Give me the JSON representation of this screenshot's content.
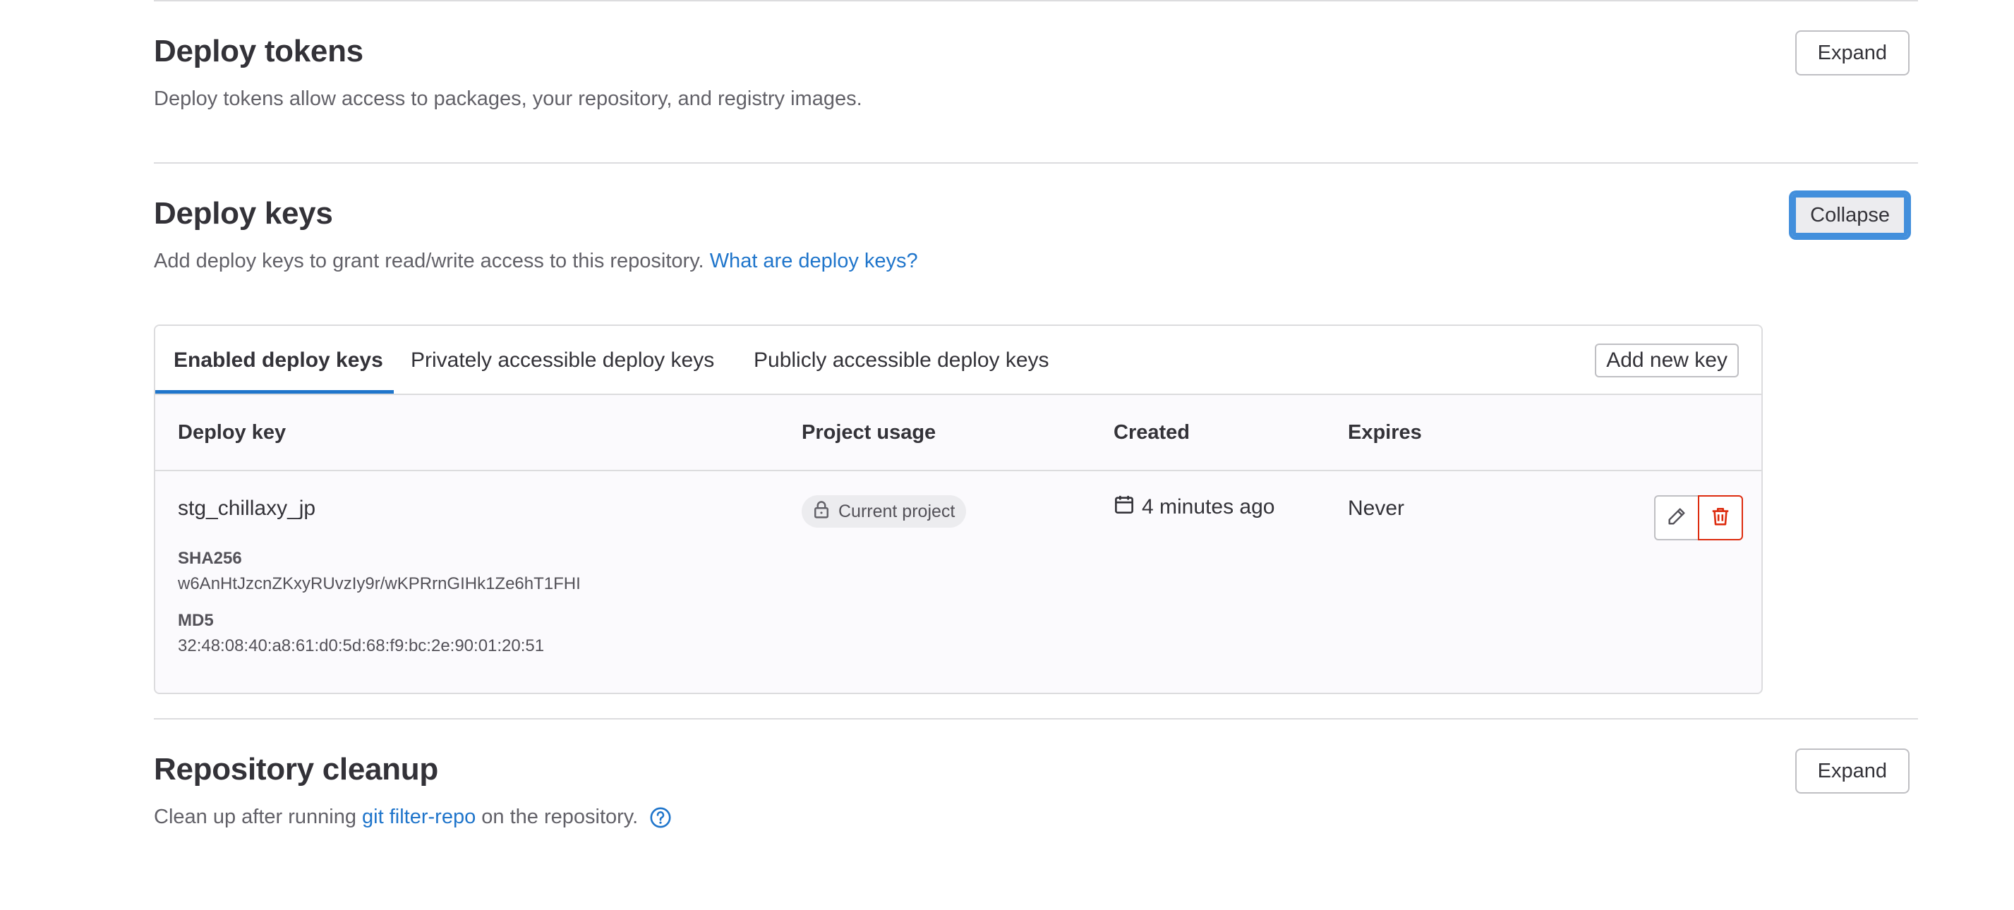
{
  "sections": {
    "deploy_tokens": {
      "title": "Deploy tokens",
      "description": "Deploy tokens allow access to packages, your repository, and registry images.",
      "button": "Expand"
    },
    "deploy_keys": {
      "title": "Deploy keys",
      "description": "Add deploy keys to grant read/write access to this repository.",
      "help_link": "What are deploy keys?",
      "button": "Collapse"
    },
    "repository_cleanup": {
      "title": "Repository cleanup",
      "description_prefix": "Clean up after running",
      "description_link": "git filter-repo",
      "description_suffix": "on the repository.",
      "button": "Expand"
    }
  },
  "deploy_keys_panel": {
    "tabs": [
      {
        "label": "Enabled deploy keys",
        "active": true
      },
      {
        "label": "Privately accessible deploy keys",
        "active": false
      },
      {
        "label": "Publicly accessible deploy keys",
        "active": false
      }
    ],
    "add_button": "Add new key",
    "columns": [
      "Deploy key",
      "Project usage",
      "Created",
      "Expires"
    ],
    "rows": [
      {
        "title": "stg_chillaxy_jp",
        "sha256_label": "SHA256",
        "sha256": "w6AnHtJzcnZKxyRUvzIy9r/wKPRrnGIHk1Ze6hT1FHI",
        "md5_label": "MD5",
        "md5": "32:48:08:40:a8:61:d0:5d:68:f9:bc:2e:90:01:20:51",
        "project_usage": "Current project",
        "created": "4 minutes ago",
        "expires": "Never"
      }
    ]
  },
  "icons": {
    "lock": "lock-icon",
    "calendar": "calendar-icon",
    "edit": "pencil-icon",
    "delete": "trash-icon",
    "help": "question-circle-icon"
  },
  "colors": {
    "link": "#1f75cb",
    "danger": "#dd2b0e",
    "text": "#333238",
    "muted": "#626168",
    "border": "#dcdcde"
  }
}
